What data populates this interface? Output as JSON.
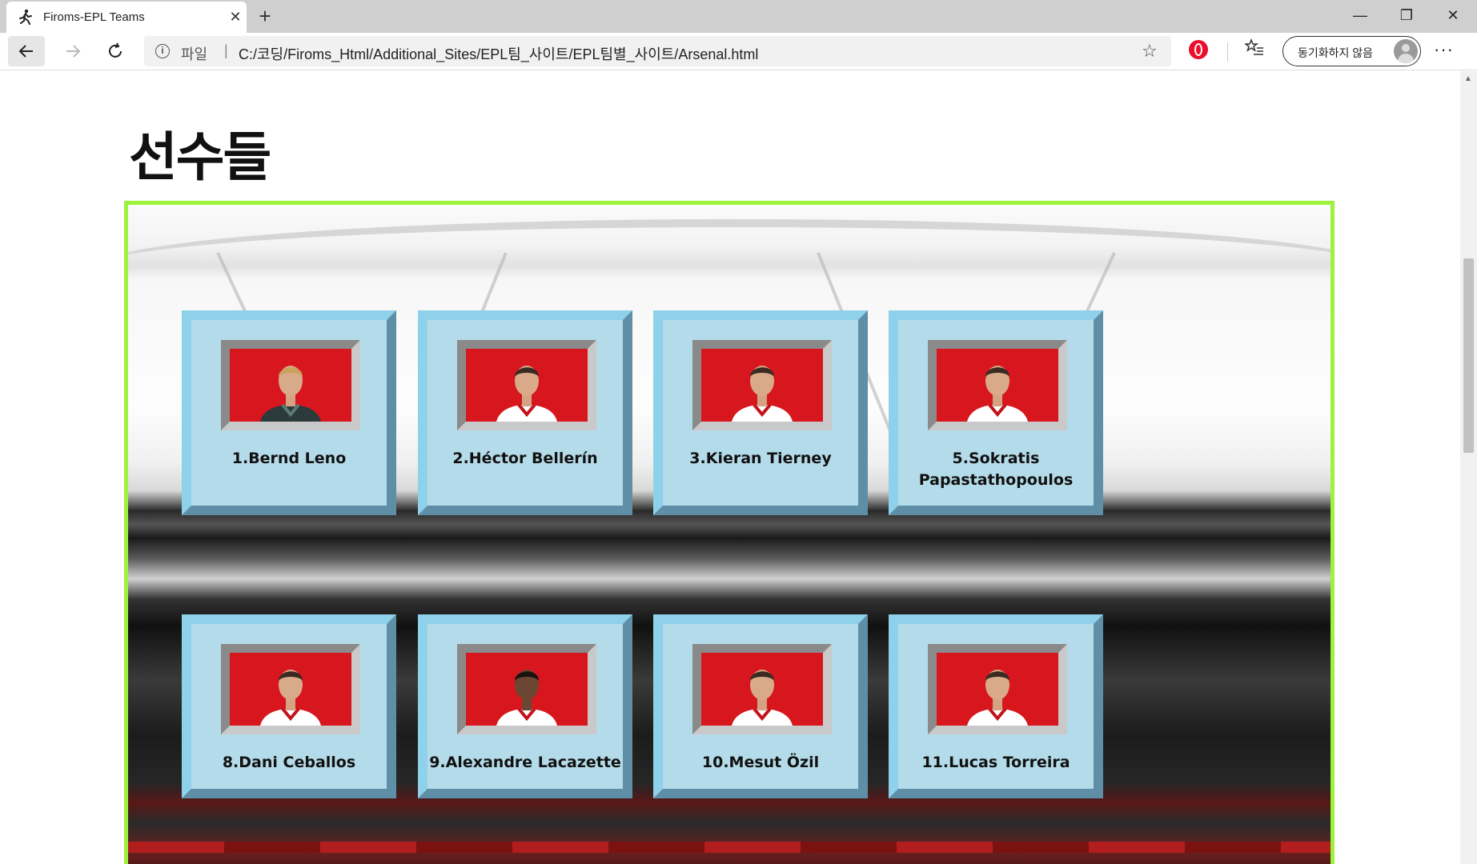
{
  "browser": {
    "tab_title": "Firoms-EPL Teams",
    "tab_close": "✕",
    "new_tab": "+",
    "window_controls": {
      "minimize": "—",
      "restore": "❐",
      "close": "✕"
    },
    "address": {
      "scheme_label": "파일",
      "separator": "|",
      "url": "C:/코딩/Firoms_Html/Additional_Sites/EPL팀_사이트/EPL팀별_사이트/Arsenal.html"
    },
    "sync_label": "동기화하지 않음",
    "more": "···"
  },
  "page": {
    "heading": "선수들",
    "players": [
      {
        "name": "1.Bernd Leno",
        "kit": "goalkeeper"
      },
      {
        "name": "2.Héctor Bellerín",
        "kit": "home"
      },
      {
        "name": "3.Kieran Tierney",
        "kit": "home"
      },
      {
        "name": "5.Sokratis Papastathopoulos",
        "kit": "home"
      },
      {
        "name": "8.Dani Ceballos",
        "kit": "home"
      },
      {
        "name": "9.Alexandre Lacazette",
        "kit": "home"
      },
      {
        "name": "10.Mesut Özil",
        "kit": "home"
      },
      {
        "name": "11.Lucas Torreira",
        "kit": "home"
      }
    ]
  },
  "colors": {
    "frame_border": "#9cf33c",
    "card_face": "#b4dbe9",
    "photo_bg": "#d7171d"
  }
}
